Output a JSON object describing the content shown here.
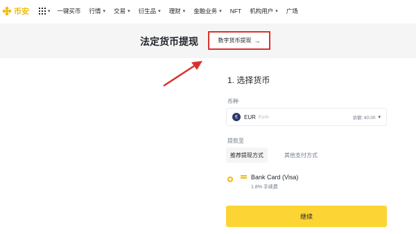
{
  "brand": {
    "name": "币安",
    "accent_color": "#f0b90b"
  },
  "nav": {
    "items": [
      {
        "label": "一键买币",
        "has_caret": false
      },
      {
        "label": "行情",
        "has_caret": true
      },
      {
        "label": "交易",
        "has_caret": true
      },
      {
        "label": "衍生品",
        "has_caret": true
      },
      {
        "label": "理财",
        "has_caret": true
      },
      {
        "label": "金融业务",
        "has_caret": true
      },
      {
        "label": "NFT",
        "has_caret": false
      },
      {
        "label": "机构用户",
        "has_caret": true
      },
      {
        "label": "广场",
        "has_caret": false
      }
    ]
  },
  "header": {
    "title": "法定货币提现",
    "crypto_button_label": "数字货币提现",
    "crypto_button_arrow": "→",
    "highlight_color": "#d9302c"
  },
  "form": {
    "step_title": "1. 选择货币",
    "currency_label": "币种",
    "currency": {
      "code": "EUR",
      "name": "Euro",
      "symbol": "€",
      "balance": "余额: €0.00"
    },
    "method_label": "提款至",
    "tabs": [
      {
        "label": "推荐提现方式",
        "active": true
      },
      {
        "label": "其他支付方式",
        "active": false
      }
    ],
    "method": {
      "name": "Bank Card (Visa)",
      "fee": "1.8% 手续费",
      "selected": true
    },
    "continue_label": "继续",
    "button_color": "#fcd535"
  }
}
